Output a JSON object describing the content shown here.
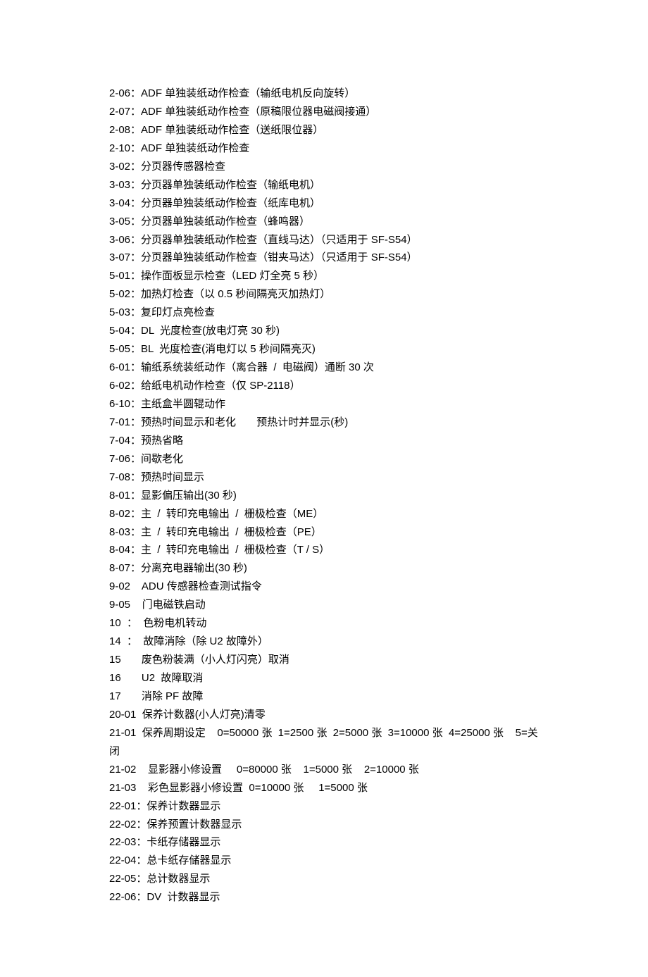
{
  "lines": [
    "2-06：ADF 单独装纸动作检查（输纸电机反向旋转）",
    "2-07：ADF 单独装纸动作检查（原稿限位器电磁阀接通）",
    "2-08：ADF 单独装纸动作检查（送纸限位器）",
    "2-10：ADF 单独装纸动作检查",
    "3-02：分页器传感器检查",
    "3-03：分页器单独装纸动作检查（输纸电机）",
    "3-04：分页器单独装纸动作检查（纸库电机）",
    "3-05：分页器单独装纸动作检查（蜂鸣器）",
    "3-06：分页器单独装纸动作检查（直线马达）（只适用于 SF-S54）",
    "3-07：分页器单独装纸动作检查（钳夹马达）（只适用于 SF-S54）",
    "5-01：操作面板显示检查（LED 灯全亮 5 秒）",
    "5-02：加热灯检查（以 0.5 秒间隔亮灭加热灯）",
    "5-03：复印灯点亮检查",
    "5-04：DL  光度检查(放电灯亮 30 秒)",
    "5-05：BL  光度检查(消电灯以 5 秒间隔亮灭)",
    "6-01：输纸系统装纸动作（离合器  /  电磁阀）通断 30 次",
    "6-02：给纸电机动作检查（仅 SP-2118）",
    "6-10：主纸盒半圆辊动作",
    "7-01：预热时间显示和老化       预热计时并显示(秒)",
    "7-04：预热省略",
    "7-06：间歇老化",
    "7-08：预热时间显示",
    "8-01：显影偏压输出(30 秒)",
    "8-02：主  /  转印充电输出  /  栅极检查（ME）",
    "8-03：主  /  转印充电输出  /  栅极检查（PE）",
    "8-04：主  /  转印充电输出  /  栅极检查（T / S）",
    "8-07：分离充电器输出(30 秒)",
    "9-02    ADU 传感器检查测试指令",
    "9-05    门电磁铁启动",
    "10  ：  色粉电机转动",
    "14  ：  故障消除（除 U2 故障外）",
    "15       废色粉装满（小人灯闪亮）取消",
    "16       U2  故障取消",
    "17       消除 PF 故障",
    "20-01  保养计数器(小人灯亮)清零",
    "21-01  保养周期设定    0=50000 张  1=2500 张  2=5000 张  3=10000 张  4=25000 张    5=关闭",
    "21-02    显影器小修设置     0=80000 张    1=5000 张    2=10000 张",
    "21-03    彩色显影器小修设置  0=10000 张     1=5000 张",
    "22-01：保养计数器显示",
    "22-02：保养预置计数器显示",
    "22-03：卡纸存储器显示",
    "22-04：总卡纸存储器显示",
    "22-05：总计数器显示",
    "22-06：DV  计数器显示"
  ]
}
